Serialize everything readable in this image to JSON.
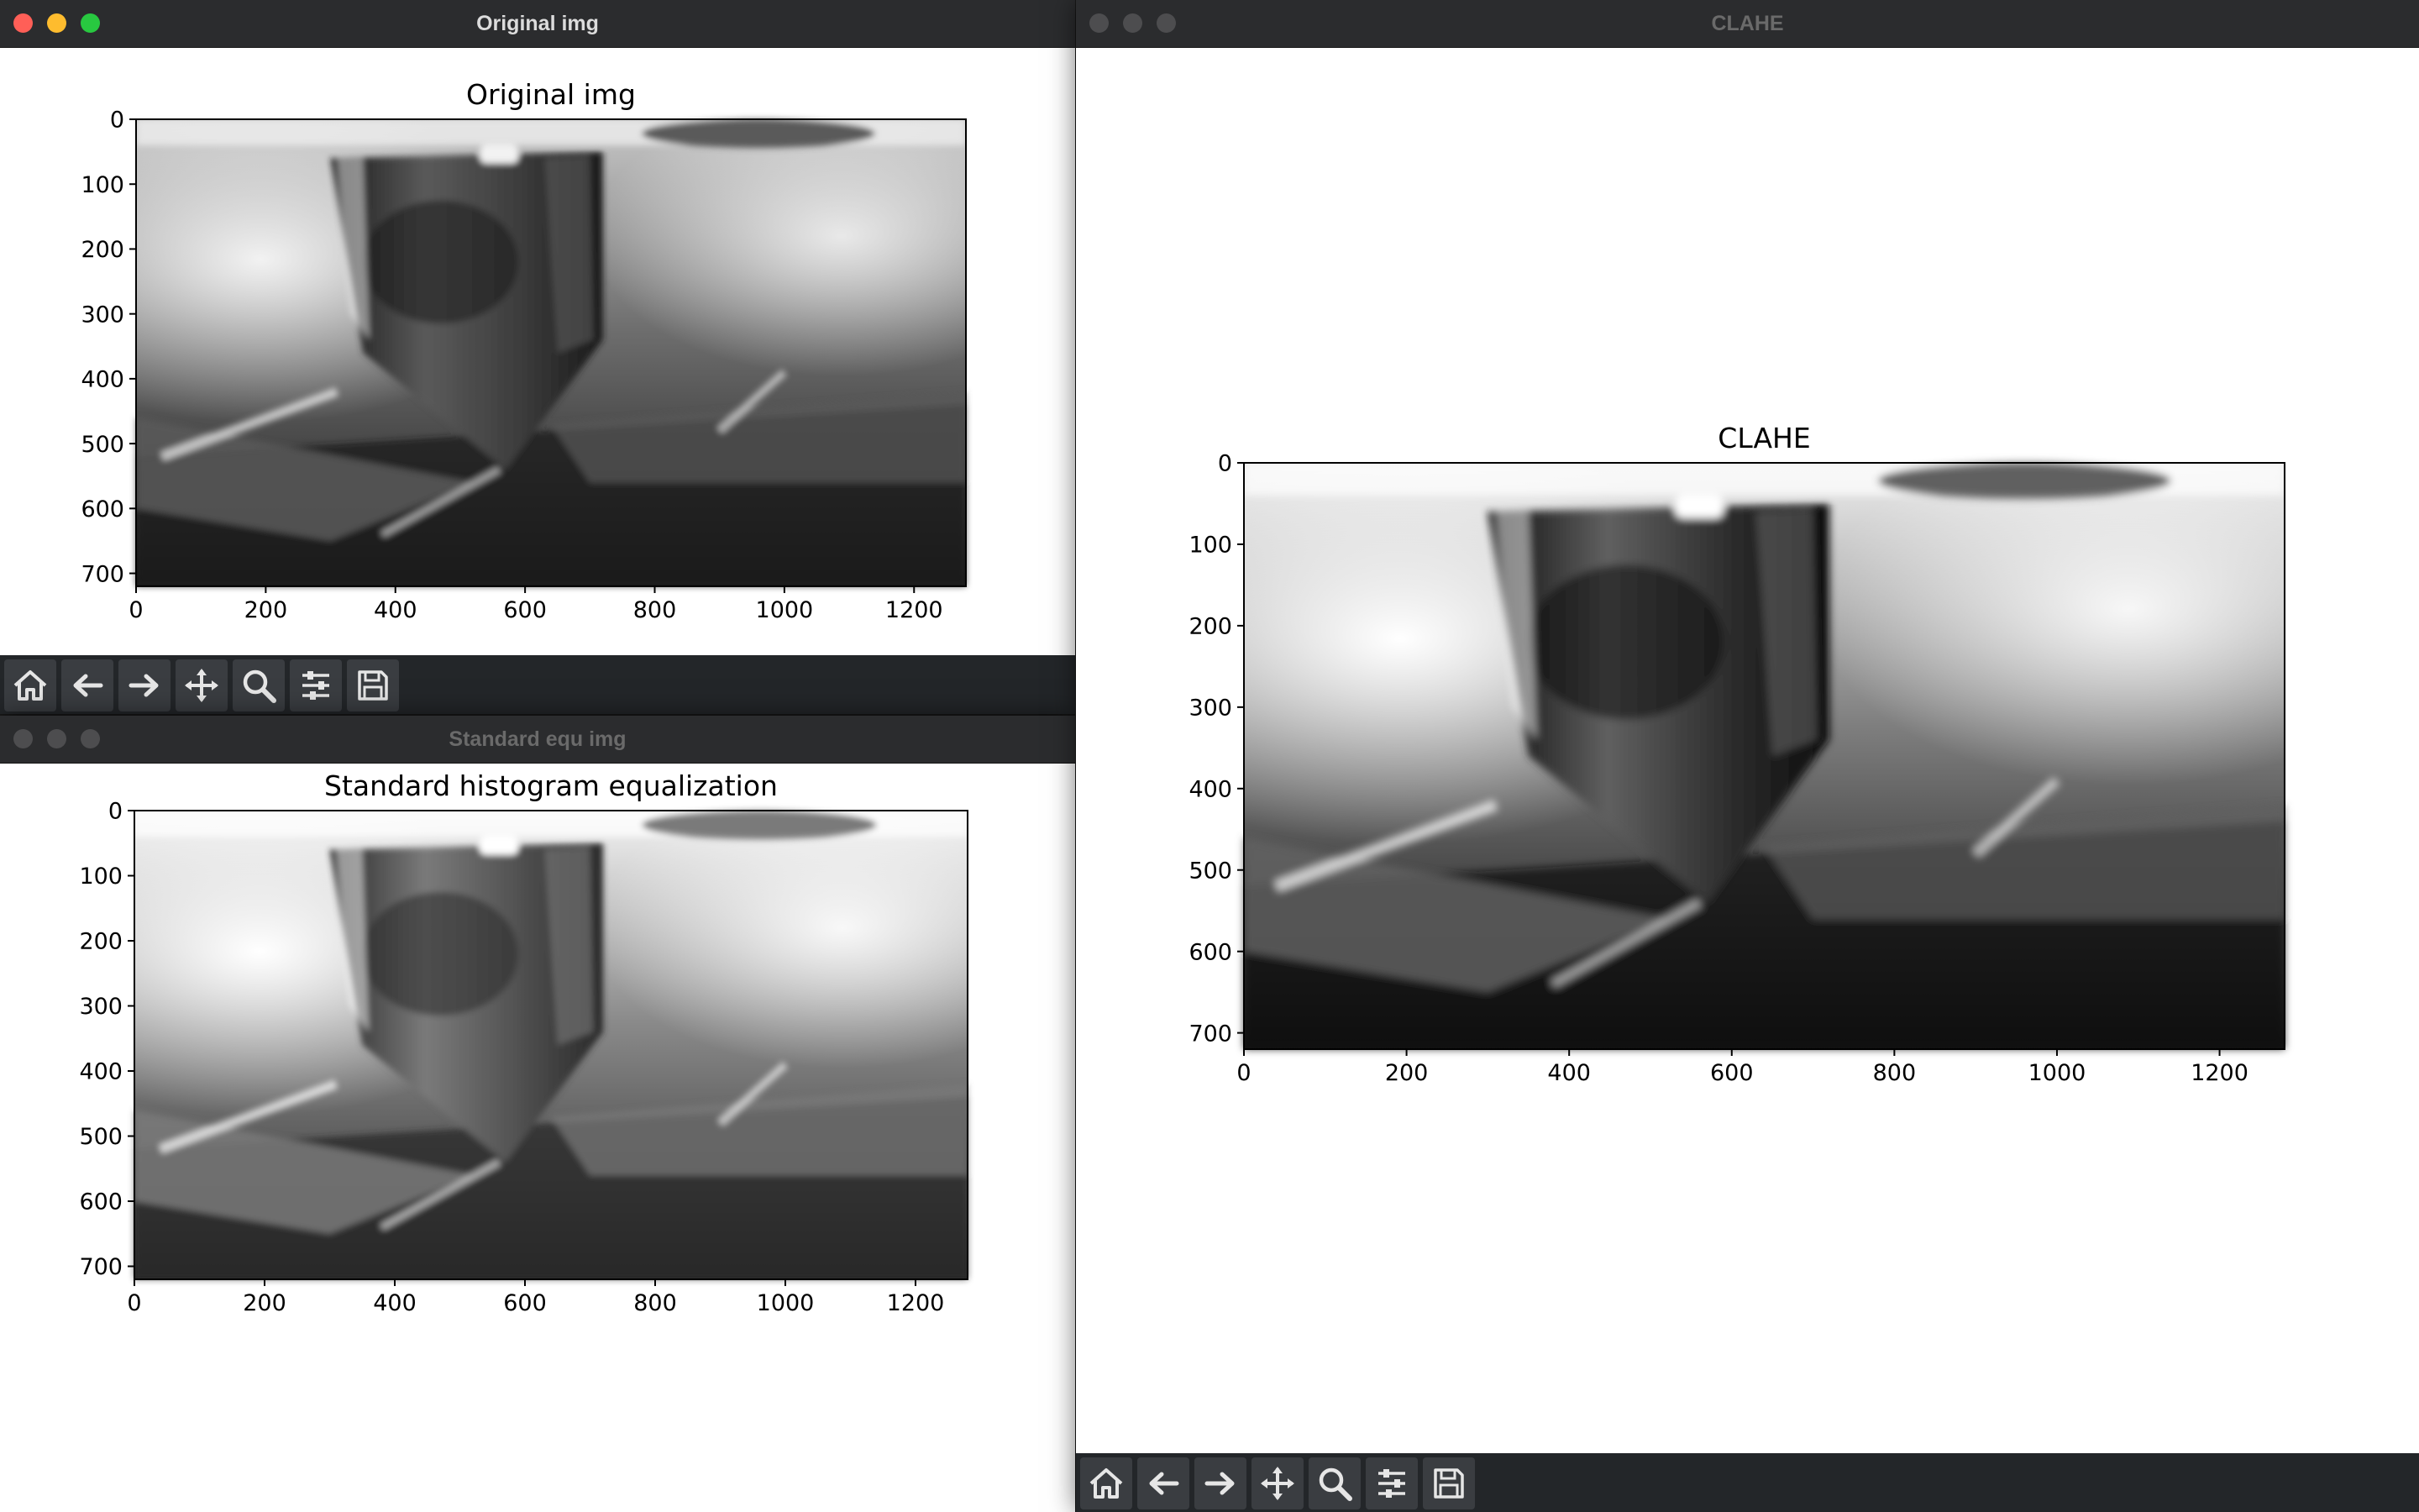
{
  "windows": {
    "original": {
      "title": "Original img"
    },
    "standard": {
      "title": "Standard equ img"
    },
    "clahe": {
      "title": "CLAHE"
    }
  },
  "figures": {
    "original": {
      "plot_title": "Original img"
    },
    "standard": {
      "plot_title": "Standard histogram equalization"
    },
    "clahe": {
      "plot_title": "CLAHE"
    }
  },
  "chart_data": [
    {
      "type": "image",
      "title": "Original img",
      "xticks": [
        0,
        200,
        400,
        600,
        800,
        1000,
        1200
      ],
      "yticks": [
        0,
        100,
        200,
        300,
        400,
        500,
        600,
        700
      ],
      "xlim": [
        0,
        1280
      ],
      "ylim": [
        720,
        0
      ],
      "colormap": "gray"
    },
    {
      "type": "image",
      "title": "Standard histogram equalization",
      "xticks": [
        0,
        200,
        400,
        600,
        800,
        1000,
        1200
      ],
      "yticks": [
        0,
        100,
        200,
        300,
        400,
        500,
        600,
        700
      ],
      "xlim": [
        0,
        1280
      ],
      "ylim": [
        720,
        0
      ],
      "colormap": "gray"
    },
    {
      "type": "image",
      "title": "CLAHE",
      "xticks": [
        0,
        200,
        400,
        600,
        800,
        1000,
        1200
      ],
      "yticks": [
        0,
        100,
        200,
        300,
        400,
        500,
        600,
        700
      ],
      "xlim": [
        0,
        1280
      ],
      "ylim": [
        720,
        0
      ],
      "colormap": "gray"
    }
  ],
  "toolbar": {
    "buttons": [
      {
        "icon": "home-icon"
      },
      {
        "icon": "arrow-left-icon"
      },
      {
        "icon": "arrow-right-icon"
      },
      {
        "icon": "move-icon"
      },
      {
        "icon": "zoom-icon"
      },
      {
        "icon": "sliders-icon"
      },
      {
        "icon": "save-icon"
      }
    ]
  },
  "colors": {
    "traffic_close": "#ff5f57",
    "traffic_minimize": "#febc2e",
    "traffic_zoom": "#28c840",
    "toolbar_bg": "#232629",
    "titlebar_bg": "#2b2c2e"
  }
}
